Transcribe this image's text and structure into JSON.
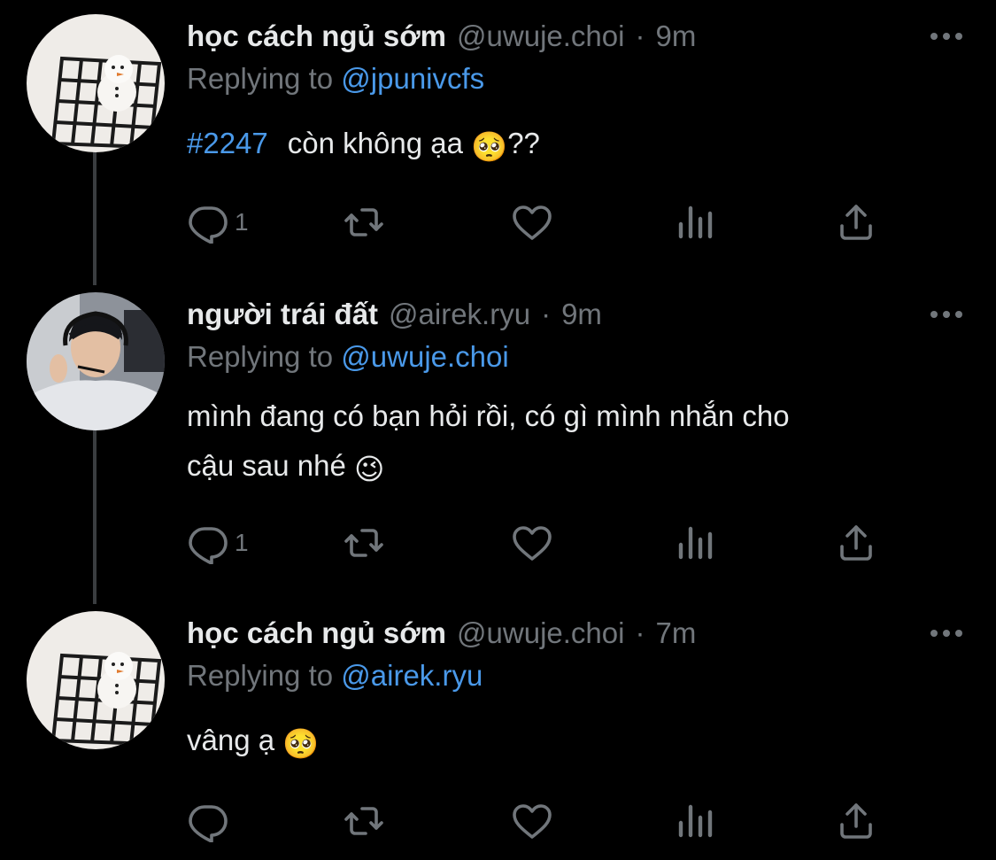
{
  "tweets": [
    {
      "display_name": "học cách ngủ sớm",
      "handle": "@uwuje.choi",
      "separator": "·",
      "time": "9m",
      "replying_prefix": "Replying to",
      "replying_to": "@jpunivcfs",
      "hashtag": "#2247",
      "text_line1": "còn không ạa",
      "emoji1": "🥺",
      "text_suffix": "??",
      "text_line2": "",
      "reply_count": "1",
      "avatar": "snowman-on-grid"
    },
    {
      "display_name": "người trái đất",
      "handle": "@airek.ryu",
      "separator": "·",
      "time": "9m",
      "replying_prefix": "Replying to",
      "replying_to": "@uwuje.choi",
      "text_line1": "mình đang có bạn hỏi rồi, có gì mình nhắn cho",
      "text_line2": "cậu sau nhé",
      "emoji2": "😉",
      "reply_count": "1",
      "avatar": "person-with-headset"
    },
    {
      "display_name": "học cách ngủ sớm",
      "handle": "@uwuje.choi",
      "separator": "·",
      "time": "7m",
      "replying_prefix": "Replying to",
      "replying_to": "@airek.ryu",
      "text_line1": "vâng ạ",
      "emoji1": "🥺",
      "reply_count": "",
      "avatar": "snowman-on-grid"
    }
  ],
  "icons": {
    "reply": "reply-icon",
    "retweet": "retweet-icon",
    "like": "like-icon",
    "views": "views-icon",
    "share": "share-icon",
    "more": "more-icon"
  },
  "colors": {
    "background": "#000000",
    "text": "#e7e9ea",
    "muted": "#71767b",
    "link": "#4a99e9",
    "thread_line": "#3a3d40"
  }
}
